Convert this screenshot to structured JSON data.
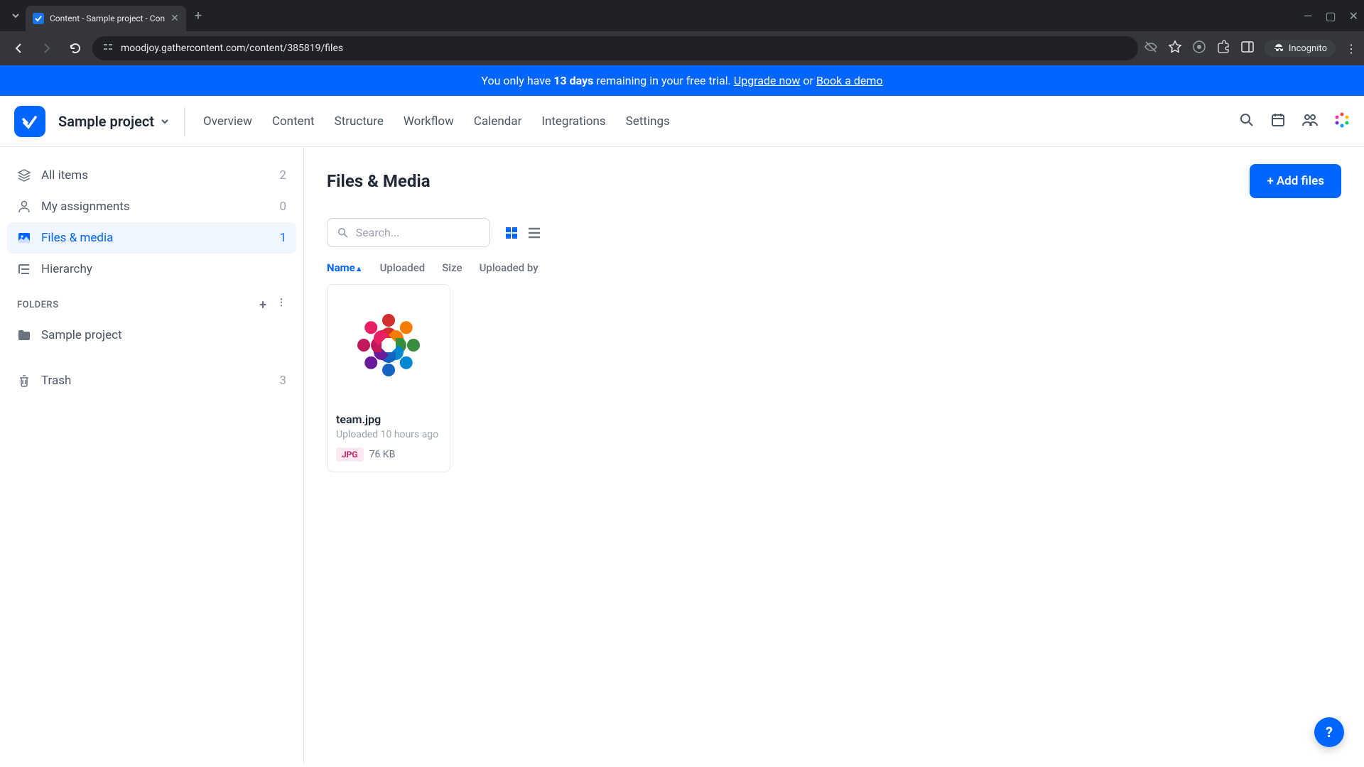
{
  "browser": {
    "tab_title": "Content - Sample project - Con",
    "url": "moodjoy.gathercontent.com/content/385819/files",
    "incognito_label": "Incognito"
  },
  "banner": {
    "prefix": "You only have ",
    "days": "13 days",
    "middle": " remaining in your free trial. ",
    "upgrade": "Upgrade now",
    "or": " or ",
    "demo": "Book a demo"
  },
  "header": {
    "project_name": "Sample project",
    "tabs": [
      "Overview",
      "Content",
      "Structure",
      "Workflow",
      "Calendar",
      "Integrations",
      "Settings"
    ]
  },
  "sidebar": {
    "items": [
      {
        "label": "All items",
        "count": "2"
      },
      {
        "label": "My assignments",
        "count": "0"
      },
      {
        "label": "Files & media",
        "count": "1"
      },
      {
        "label": "Hierarchy",
        "count": ""
      }
    ],
    "folders_label": "FOLDERS",
    "folders": [
      {
        "label": "Sample project"
      }
    ],
    "trash": {
      "label": "Trash",
      "count": "3"
    }
  },
  "main": {
    "title": "Files & Media",
    "add_button": "Add files",
    "search_placeholder": "Search...",
    "sort_columns": [
      "Name",
      "Uploaded",
      "Size",
      "Uploaded by"
    ],
    "files": [
      {
        "name": "team.jpg",
        "uploaded": "Uploaded 10 hours ago",
        "type": "JPG",
        "size": "76 KB"
      }
    ]
  }
}
